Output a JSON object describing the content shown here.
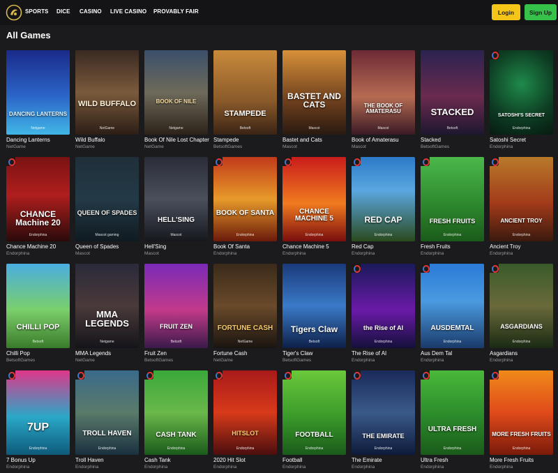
{
  "nav": [
    "SPORTS",
    "DICE",
    "CASINO",
    "LIVE CASINO",
    "PROVABLY FAIR"
  ],
  "auth": {
    "login": "Login",
    "signup": "Sign Up"
  },
  "section_title": "All Games",
  "games": [
    {
      "name": "Dancing Lanterns",
      "provider": "NetGame",
      "thumb_title": "DANCING LANTERNS",
      "thumb_provider": "Netgame",
      "badge": false
    },
    {
      "name": "Wild Buffalo",
      "provider": "NetGame",
      "thumb_title": "WILD BUFFALO",
      "thumb_provider": "NetGame",
      "badge": false
    },
    {
      "name": "Book Of Nile Lost Chapter",
      "provider": "NetGame",
      "thumb_title": "BOOK OF NILE",
      "thumb_provider": "Netgame",
      "badge": false
    },
    {
      "name": "Stampede",
      "provider": "BetsoftGames",
      "thumb_title": "STAMPEDE",
      "thumb_provider": "Betsoft",
      "badge": false
    },
    {
      "name": "Bastet and Cats",
      "provider": "Mascot",
      "thumb_title": "BASTET AND CATS",
      "thumb_provider": "Mascot",
      "badge": false
    },
    {
      "name": "Book of Amaterasu",
      "provider": "Mascot",
      "thumb_title": "THE BOOK OF AMATERASU",
      "thumb_provider": "Mascot",
      "badge": false
    },
    {
      "name": "Stacked",
      "provider": "BetsoftGames",
      "thumb_title": "STACKED",
      "thumb_provider": "Betsoft",
      "badge": false
    },
    {
      "name": "Satoshi Secret",
      "provider": "Endorphina",
      "thumb_title": "SATOSHI'S SECRET",
      "thumb_provider": "Endorphina",
      "badge": true
    },
    {
      "name": "Chance Machine 20",
      "provider": "Endorphina",
      "thumb_title": "CHANCE Machine 20",
      "thumb_provider": "Endorphina",
      "badge": true
    },
    {
      "name": "Queen of Spades",
      "provider": "Mascot",
      "thumb_title": "QUEEN OF SPADES",
      "thumb_provider": "Mascot gaming",
      "badge": false
    },
    {
      "name": "Hell'Sing",
      "provider": "Mascot",
      "thumb_title": "HELL'SING",
      "thumb_provider": "Mascot",
      "badge": false
    },
    {
      "name": "Book Of Santa",
      "provider": "Endorphina",
      "thumb_title": "BOOK OF SANTA",
      "thumb_provider": "Endorphina",
      "badge": true
    },
    {
      "name": "Chance Machine 5",
      "provider": "Endorphina",
      "thumb_title": "CHANCE MACHINE 5",
      "thumb_provider": "Endorphina",
      "badge": true
    },
    {
      "name": "Red Cap",
      "provider": "Endorphina",
      "thumb_title": "RED CAP",
      "thumb_provider": "Endorphina",
      "badge": true
    },
    {
      "name": "Fresh Fruits",
      "provider": "Endorphina",
      "thumb_title": "FRESH FRUITS",
      "thumb_provider": "Endorphina",
      "badge": true
    },
    {
      "name": "Ancient Troy",
      "provider": "Endorphina",
      "thumb_title": "ANCIENT TROY",
      "thumb_provider": "Endorphina",
      "badge": true
    },
    {
      "name": "Chilli Pop",
      "provider": "BetsoftGames",
      "thumb_title": "CHILLI POP",
      "thumb_provider": "Betsoft",
      "badge": false
    },
    {
      "name": "MMA Legends",
      "provider": "NetGame",
      "thumb_title": "MMA LEGENDS",
      "thumb_provider": "Netgame",
      "badge": false
    },
    {
      "name": "Fruit Zen",
      "provider": "BetsoftGames",
      "thumb_title": "FRUIT ZEN",
      "thumb_provider": "Betsoft",
      "badge": false
    },
    {
      "name": "Fortune Cash",
      "provider": "NetGame",
      "thumb_title": "FORTUNE CASH",
      "thumb_provider": "NetGame",
      "badge": false
    },
    {
      "name": "Tiger's Claw",
      "provider": "BetsoftGames",
      "thumb_title": "Tigers Claw",
      "thumb_provider": "Betsoft",
      "badge": false
    },
    {
      "name": "The Rise of AI",
      "provider": "Endorphina",
      "thumb_title": "the Rise of AI",
      "thumb_provider": "Endorphina",
      "badge": true
    },
    {
      "name": "Aus Dem Tal",
      "provider": "Endorphina",
      "thumb_title": "AUSDEMTAL",
      "thumb_provider": "Endorphina",
      "badge": true
    },
    {
      "name": "Asgardians",
      "provider": "Endorphina",
      "thumb_title": "ASGARDIANS",
      "thumb_provider": "Endorphina",
      "badge": true
    },
    {
      "name": "7 Bonus Up",
      "provider": "Endorphina",
      "thumb_title": "7UP",
      "thumb_provider": "Endorphina",
      "badge": true
    },
    {
      "name": "Troll Haven",
      "provider": "Endorphina",
      "thumb_title": "TROLL HAVEN",
      "thumb_provider": "Endorphina",
      "badge": true
    },
    {
      "name": "Cash Tank",
      "provider": "Endorphina",
      "thumb_title": "CASH TANK",
      "thumb_provider": "Endorphina",
      "badge": true
    },
    {
      "name": "2020 Hit Slot",
      "provider": "Endorphina",
      "thumb_title": "HITSLOT",
      "thumb_provider": "Endorphina",
      "badge": true
    },
    {
      "name": "Football",
      "provider": "Endorphina",
      "thumb_title": "FOOTBALL",
      "thumb_provider": "Endorphina",
      "badge": true
    },
    {
      "name": "The Emirate",
      "provider": "Endorphina",
      "thumb_title": "THE EMIRATE",
      "thumb_provider": "Endorphina",
      "badge": true
    },
    {
      "name": "Ultra Fresh",
      "provider": "Endorphina",
      "thumb_title": "ULTRA FRESH",
      "thumb_provider": "Endorphina",
      "badge": true
    },
    {
      "name": "More Fresh Fruits",
      "provider": "Endorphina",
      "thumb_title": "MORE FRESH FRUITS",
      "thumb_provider": "Endorphina",
      "badge": true
    }
  ]
}
